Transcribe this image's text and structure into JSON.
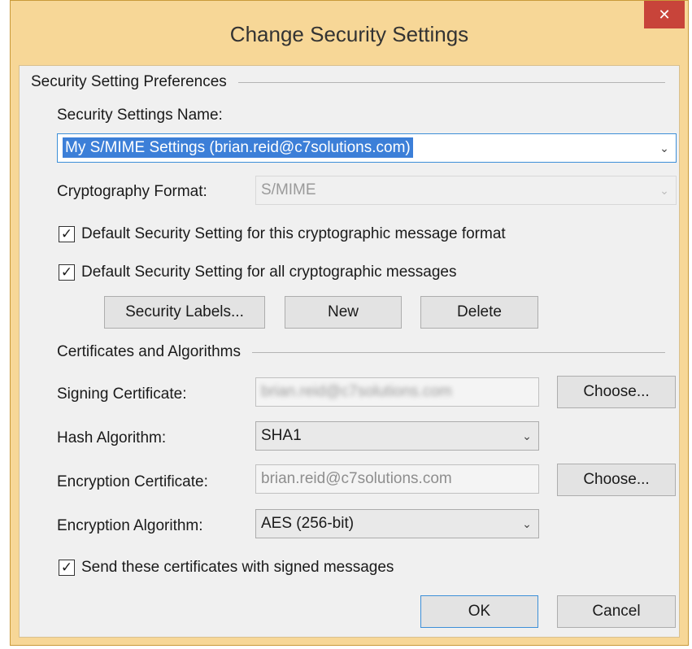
{
  "window": {
    "title": "Change Security Settings",
    "close_glyph": "✕"
  },
  "prefs": {
    "group_title": "Security Setting Preferences",
    "name_label": "Security Settings Name:",
    "name_value": "My S/MIME Settings (brian.reid@c7solutions.com)",
    "crypto_label": "Cryptography Format:",
    "crypto_value": "S/MIME",
    "default_format_label": "Default Security Setting for this cryptographic message format",
    "default_format_checked": true,
    "default_all_label": "Default Security Setting for all cryptographic messages",
    "default_all_checked": true,
    "security_labels_button": "Security Labels...",
    "new_button": "New",
    "delete_button": "Delete"
  },
  "certs": {
    "group_title": "Certificates and Algorithms",
    "signing_label": "Signing Certificate:",
    "signing_value": "brian.reid@c7solutions.com",
    "signing_choose": "Choose...",
    "hash_label": "Hash Algorithm:",
    "hash_value": "SHA1",
    "encryption_cert_label": "Encryption Certificate:",
    "encryption_cert_value": "brian.reid@c7solutions.com",
    "encryption_choose": "Choose...",
    "encryption_alg_label": "Encryption Algorithm:",
    "encryption_alg_value": "AES (256-bit)",
    "send_certs_label": "Send these certificates with signed messages",
    "send_certs_checked": true
  },
  "footer": {
    "ok_button": "OK",
    "cancel_button": "Cancel"
  },
  "icons": {
    "check": "✓",
    "chevron": "⌄"
  },
  "colors": {
    "frame": "#f7d797",
    "close": "#c8443a",
    "selection": "#3c7fd8",
    "focus_border": "#3c8fd8"
  }
}
